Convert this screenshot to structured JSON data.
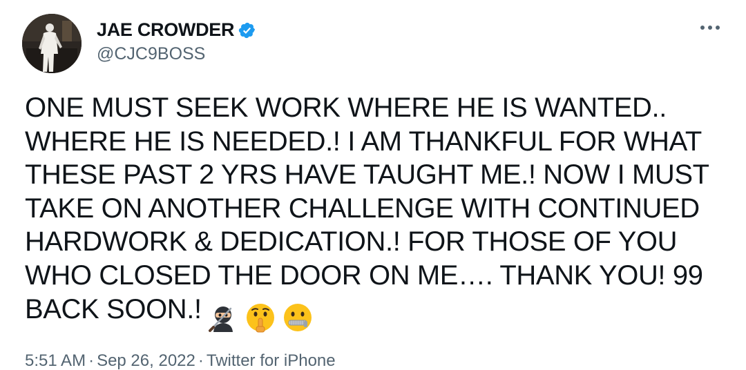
{
  "user": {
    "display_name": "JAE CROWDER",
    "handle": "@CJC9BOSS",
    "verified_color": "#1d9bf0"
  },
  "tweet": {
    "lines": [
      "ONE MUST SEEK WORK WHERE HE IS WANTED..",
      "WHERE HE IS NEEDED.! I AM THANKFUL FOR WHAT",
      "THESE PAST 2 YRS HAVE TAUGHT ME.! NOW I MUST",
      "TAKE ON ANOTHER CHALLENGE WITH CONTINUED",
      "HARDWORK & DEDICATION.! FOR THOSE OF YOU",
      "WHO CLOSED THE DOOR ON ME…. THANK YOU! 99",
      "BACK SOON.!"
    ],
    "emojis": [
      "ninja-emoji",
      "shushing-face-emoji",
      "zipper-mouth-face-emoji"
    ]
  },
  "meta": {
    "time": "5:51 AM",
    "separator": "·",
    "date": "Sep 26, 2022",
    "source": "Twitter for iPhone"
  },
  "icons": {
    "more": "more-options-icon",
    "verified": "verified-badge-icon"
  }
}
